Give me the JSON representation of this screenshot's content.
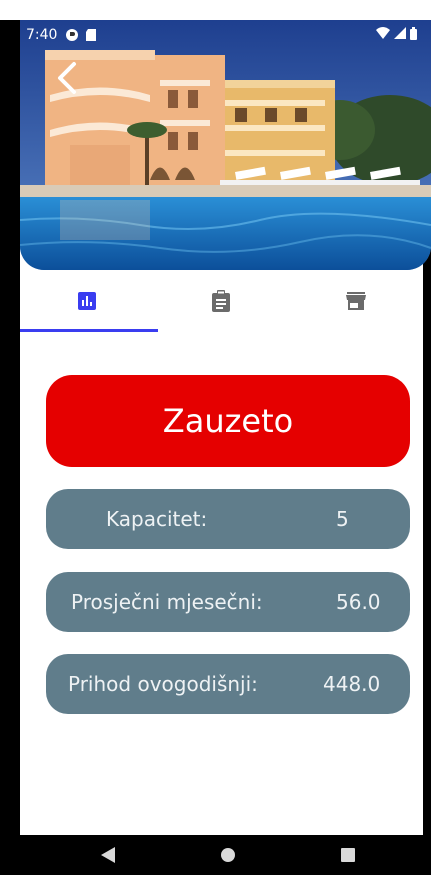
{
  "status_bar": {
    "time": "7:40",
    "icons": [
      "data-saver-icon",
      "sd-card-icon",
      "wifi-icon",
      "signal-icon",
      "battery-icon"
    ]
  },
  "header": {
    "back_icon": "chevron-left-icon"
  },
  "tabs": [
    {
      "icon": "bar-chart-icon",
      "active": true
    },
    {
      "icon": "clipboard-icon",
      "active": false
    },
    {
      "icon": "store-icon",
      "active": false
    }
  ],
  "status": {
    "label": "Zauzeto",
    "color": "#e50000"
  },
  "stats": [
    {
      "label": "Kapacitet:",
      "value": "5"
    },
    {
      "label": "Prosječni mjesečni:",
      "value": "56.0"
    },
    {
      "label": "Prihod ovogodišnji:",
      "value": "448.0"
    }
  ],
  "colors": {
    "accent": "#3a3df0",
    "stat_bg": "#607d8b",
    "tab_inactive": "#6b6b6b"
  },
  "nav": {
    "icons": [
      "back-triangle-icon",
      "home-circle-icon",
      "recents-square-icon"
    ]
  }
}
